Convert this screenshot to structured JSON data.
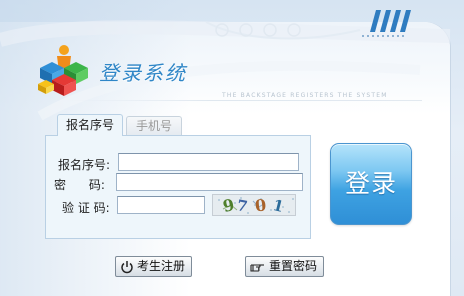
{
  "header": {
    "title": "登录系统",
    "tagline": "THE BACKSTAGE REGISTERS THE SYSTEM"
  },
  "tabs": [
    {
      "label": "报名序号",
      "active": true
    },
    {
      "label": "手机号",
      "active": false
    }
  ],
  "form": {
    "registration_number": {
      "label": "报名序号:",
      "value": ""
    },
    "password": {
      "label": "密      码:",
      "value": ""
    },
    "captcha": {
      "label": "验 证 码:",
      "value": "",
      "image_text": "9701"
    }
  },
  "buttons": {
    "login": "登录",
    "register": "考生注册",
    "reset_password": "重置密码"
  },
  "icons": {
    "logo": "colored-cubes-person-logo",
    "register": "power-icon",
    "reset": "hand-pointer-icon"
  },
  "colors": {
    "accent": "#2f86c7",
    "login_button": "#3ea2e2",
    "form_background": "#eef6fb",
    "form_border": "#b9d0e4"
  }
}
